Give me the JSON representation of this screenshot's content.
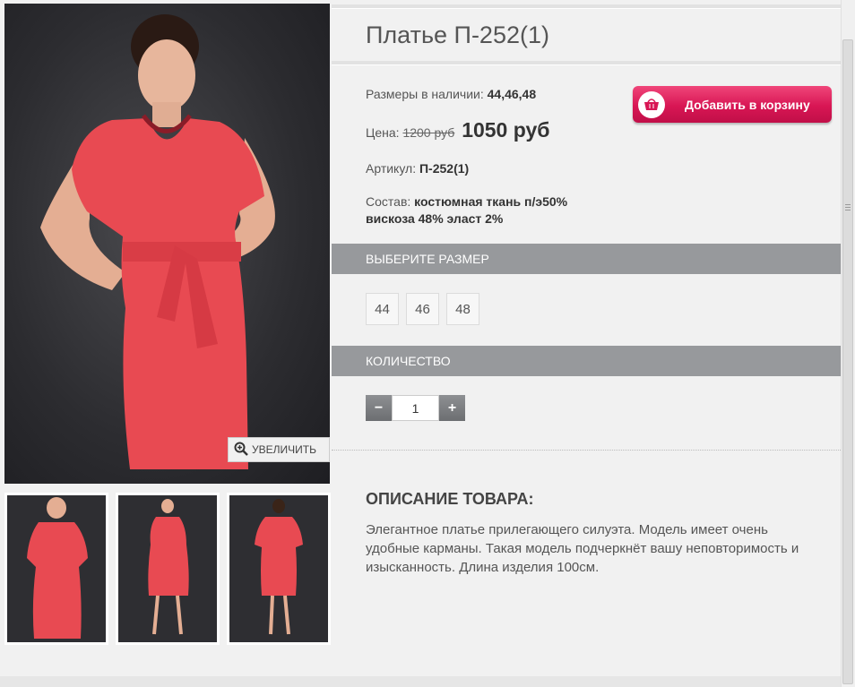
{
  "product": {
    "title": "Платье П-252(1)",
    "sizes_label": "Размеры в наличии:",
    "sizes_value": "44,46,48",
    "price_label": "Цена:",
    "old_price": "1200 руб",
    "new_price": "1050 руб",
    "article_label": "Артикул:",
    "article_value": "П-252(1)",
    "composition_label": "Состав:",
    "composition_line1": "костюмная ткань п/э50%",
    "composition_line2": "вискоза 48% эласт 2%"
  },
  "cart": {
    "add_label": "Добавить в корзину",
    "icon": "basket-icon"
  },
  "gallery": {
    "zoom_label": "УВЕЛИЧИТЬ",
    "zoom_icon": "magnifier-plus-icon"
  },
  "size_section": {
    "header": "Выберите размер",
    "options": [
      "44",
      "46",
      "48"
    ]
  },
  "quantity_section": {
    "header": "Количество",
    "minus": "−",
    "plus": "+",
    "value": "1"
  },
  "description": {
    "title": "ОПИСАНИЕ ТОВАРА:",
    "text": "Элегантное платье прилегающего силуэта. Модель имеет очень удобные карманы. Такая модель подчеркнёт вашу неповторимость и изысканность. Длина изделия 100см."
  },
  "colors": {
    "dress": "#e84a52",
    "cart_button": "#d81654",
    "bar": "#97999c"
  }
}
